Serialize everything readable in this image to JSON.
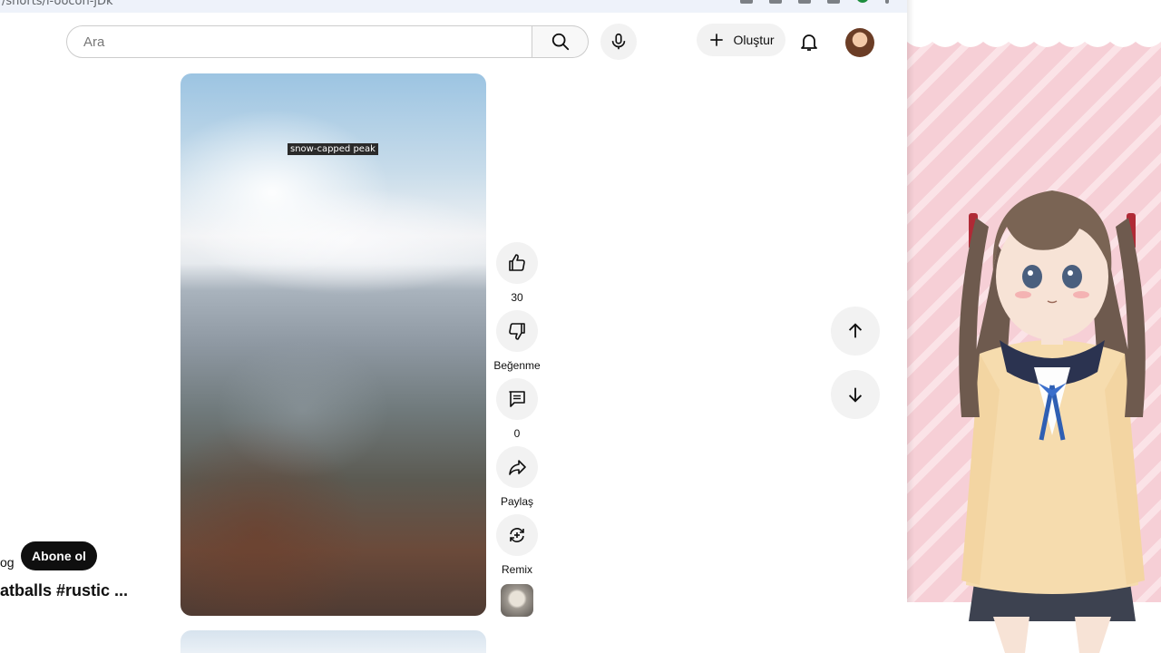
{
  "browser": {
    "url_fragment": "/shorts/i-oocon-jDk"
  },
  "header": {
    "search": {
      "placeholder": "Ara",
      "value": ""
    },
    "create_label": "Oluştur"
  },
  "video": {
    "overlay_label": "snow-capped peak"
  },
  "actions": {
    "like_count": "30",
    "dislike_label": "Beğenme",
    "comment_count": "0",
    "share_label": "Paylaş",
    "remix_label": "Remix"
  },
  "channel": {
    "name_fragment": "og",
    "subscribe_label": "Abone ol"
  },
  "short_title_fragment": "atballs #rustic ...",
  "icons": [
    "search-icon",
    "mic-icon",
    "plus-icon",
    "bell-icon",
    "like-icon",
    "dislike-icon",
    "comment-icon",
    "share-icon",
    "remix-icon",
    "arrow-up-icon",
    "arrow-down-icon"
  ],
  "colors": {
    "subscribe_bg": "#0f0f0f",
    "panel_pink": "#f6cfd6",
    "button_bg": "#f2f2f2"
  }
}
